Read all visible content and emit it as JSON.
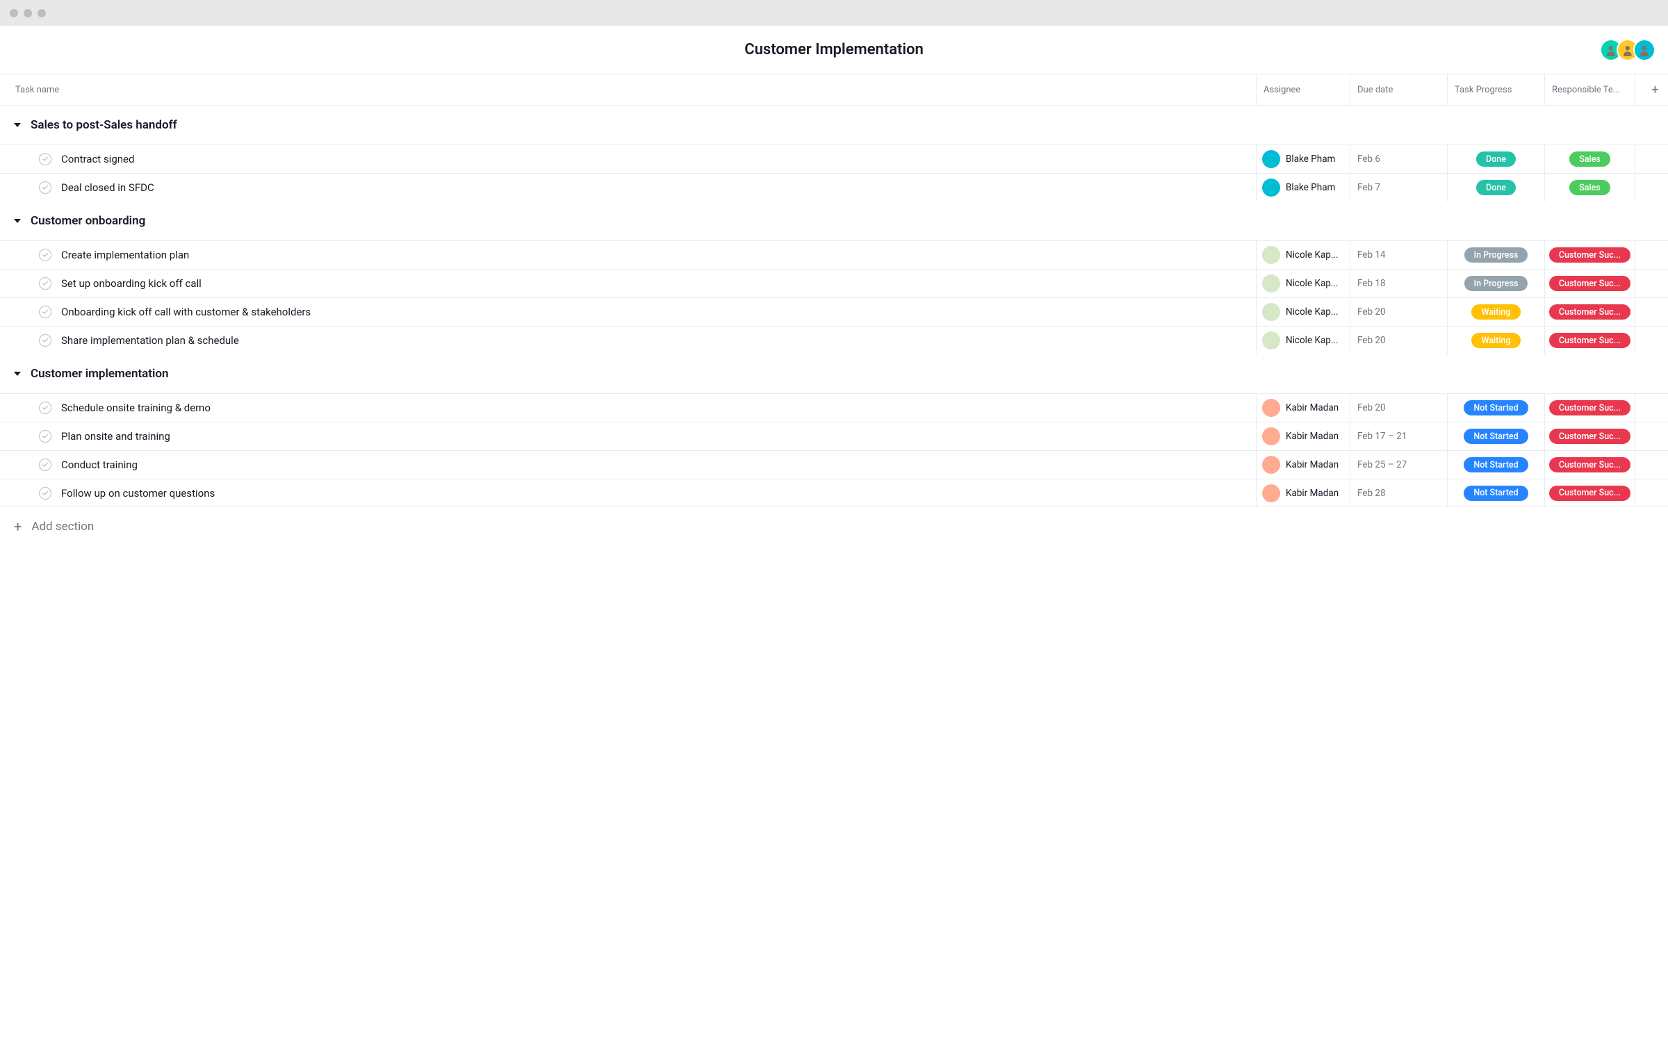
{
  "header": {
    "title": "Customer Implementation",
    "avatars": [
      {
        "bg": "#00d4b1"
      },
      {
        "bg": "#ffca28"
      },
      {
        "bg": "#00bcd4"
      }
    ]
  },
  "columns": {
    "task_name": "Task name",
    "assignee": "Assignee",
    "due_date": "Due date",
    "progress": "Task Progress",
    "team": "Responsible Te..."
  },
  "progress_classes": {
    "Done": "done",
    "In Progress": "inprogress",
    "Waiting": "waiting",
    "Not Started": "notstarted"
  },
  "team_classes": {
    "Sales": "sales",
    "Customer Suc...": "cs"
  },
  "assignee_colors": {
    "Blake Pham": "#00bcd4",
    "Nicole Kap...": "#d6e8c6",
    "Kabir Madan": "#ffab91"
  },
  "sections": [
    {
      "title": "Sales to post-Sales handoff",
      "tasks": [
        {
          "name": "Contract signed",
          "assignee": "Blake Pham",
          "due": "Feb 6",
          "progress": "Done",
          "team": "Sales"
        },
        {
          "name": "Deal closed in SFDC",
          "assignee": "Blake Pham",
          "due": "Feb 7",
          "progress": "Done",
          "team": "Sales"
        }
      ]
    },
    {
      "title": "Customer onboarding",
      "tasks": [
        {
          "name": "Create implementation plan",
          "assignee": "Nicole Kap...",
          "due": "Feb 14",
          "progress": "In Progress",
          "team": "Customer Suc..."
        },
        {
          "name": "Set up onboarding kick off call",
          "assignee": "Nicole Kap...",
          "due": "Feb 18",
          "progress": "In Progress",
          "team": "Customer Suc..."
        },
        {
          "name": "Onboarding kick off call with customer & stakeholders",
          "assignee": "Nicole Kap...",
          "due": "Feb 20",
          "progress": "Waiting",
          "team": "Customer Suc..."
        },
        {
          "name": "Share implementation plan & schedule",
          "assignee": "Nicole Kap...",
          "due": "Feb 20",
          "progress": "Waiting",
          "team": "Customer Suc..."
        }
      ]
    },
    {
      "title": "Customer implementation",
      "tasks": [
        {
          "name": "Schedule onsite training & demo",
          "assignee": "Kabir Madan",
          "due": "Feb 20",
          "progress": "Not Started",
          "team": "Customer Suc..."
        },
        {
          "name": "Plan onsite and training",
          "assignee": "Kabir Madan",
          "due": "Feb 17 – 21",
          "progress": "Not Started",
          "team": "Customer Suc..."
        },
        {
          "name": "Conduct training",
          "assignee": "Kabir Madan",
          "due": "Feb 25 – 27",
          "progress": "Not Started",
          "team": "Customer Suc..."
        },
        {
          "name": "Follow up on customer questions",
          "assignee": "Kabir Madan",
          "due": "Feb 28",
          "progress": "Not Started",
          "team": "Customer Suc..."
        }
      ]
    }
  ],
  "add_section_label": "Add section"
}
